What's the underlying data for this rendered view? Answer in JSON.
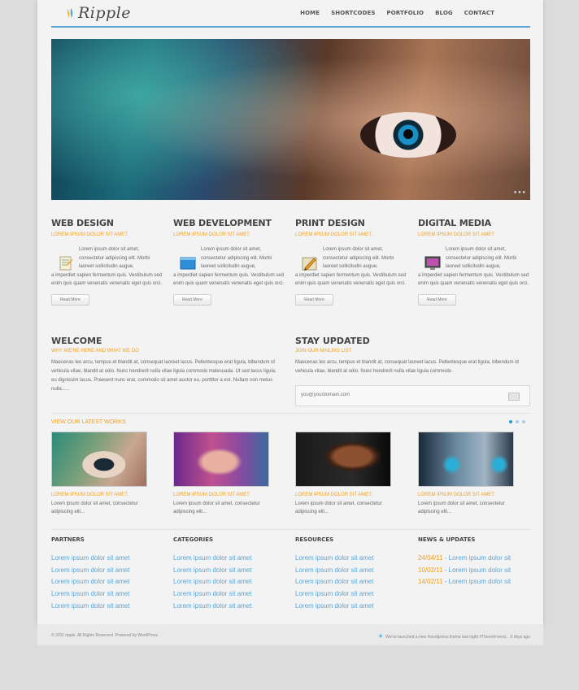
{
  "colors": {
    "accent_blue": "#5aa5d6",
    "accent_orange": "#f0a020",
    "page_bg": "#f3f3f3",
    "outer_bg": "#dcdcdc"
  },
  "header": {
    "logo_text": "Ripple",
    "nav": [
      "HOME",
      "SHORTCODES",
      "PORTFOLIO",
      "BLOG",
      "CONTACT"
    ]
  },
  "hero": {
    "icon": "slider-pager-icon"
  },
  "services": [
    {
      "title": "WEB DESIGN",
      "subtitle": "LOREM IPSUM DOLOR SIT AMET.",
      "icon": "notepad-icon",
      "text_a": "Lorem ipsum dolor sit amet, consectetur adipiscing elit. Morbi laoreet sollicitudin augue,",
      "text_b": "a imperdiet sapien fermentum quis. Vestibulum sed enim quis quam venenatis venenatis eget quis orci.",
      "button": "Read More"
    },
    {
      "title": "WEB DEVELOPMENT",
      "subtitle": "LOREM IPSUM DOLOR SIT AMET.",
      "icon": "blue-window-icon",
      "text_a": "Lorem ipsum dolor sit amet, consectetur adipiscing elit. Morbi laoreet sollicitudin augue,",
      "text_b": "a imperdiet sapien fermentum quis. Vestibulum sed enim quis quam venenatis venenatis eget quis orci.",
      "button": "Read More"
    },
    {
      "title": "PRINT DESIGN",
      "subtitle": "LOREM IPSUM DOLOR SIT AMET.",
      "icon": "pencil-icon",
      "text_a": "Lorem ipsum dolor sit amet, consectetur adipiscing elit. Morbi laoreet sollicitudin augue,",
      "text_b": "a imperdiet sapien fermentum quis. Vestibulum sed enim quis quam venenatis venenatis eget quis orci.",
      "button": "Read More"
    },
    {
      "title": "DIGITAL MEDIA",
      "subtitle": "LOREM IPSUM DOLOR SIT AMET.",
      "icon": "monitor-icon",
      "text_a": "Lorem ipsum dolor sit amet, consectetur adipiscing elit. Morbi laoreet sollicitudin augue,",
      "text_b": "a imperdiet sapien fermentum quis. Vestibulum sed enim quis quam venenatis venenatis eget quis orci.",
      "button": "Read More"
    }
  ],
  "welcome": {
    "title": "WELCOME",
    "subtitle": "WHY WE'RE HERE AND WHAT WE DO",
    "text": "Maecenas leo arcu, tempus et blandit at, consequat laoreet lacus. Pellentesque erat ligula, bibendum id vehicula vitae, blandit at odio. Nunc hendrerit nulla vitae ligula commodo malesuada. Ut sed lacus ligula, eu dignissim lacus. Praesent nunc erat, commodo sit amet auctor eu, porttitor a est. Nullam non metus nulla......"
  },
  "stay_updated": {
    "title": "STAY UPDATED",
    "subtitle": "JOIN OUR MAILING LIST",
    "text": "Maecenas leo arcu, tempus et blandit at, consequat laoreet lacus. Pellentesque erat ligula, bibendum id vehicula vitae, blandit at odio. Nunc hendrerit nulla vitae ligula commodo",
    "email_placeholder": "you@yourdomain.com"
  },
  "works": {
    "heading": "VIEW OUR LATEST WORKS",
    "items": [
      {
        "caption": "LOREM IPSUM DOLOR SIT AMET.",
        "text": "Lorem ipsum dolor sit amet, consectetur adipiscing elit..."
      },
      {
        "caption": "LOREM IPSUM DOLOR SIT AMET.",
        "text": "Lorem ipsum dolor sit amet, consectetur adipiscing elit..."
      },
      {
        "caption": "LOREM IPSUM DOLOR SIT AMET.",
        "text": "Lorem ipsum dolor sit amet, consectetur adipiscing elit..."
      },
      {
        "caption": "LOREM IPSUM DOLOR SIT AMET.",
        "text": "Lorem ipsum dolor sit amet, consectetur adipiscing elit..."
      }
    ]
  },
  "footer_columns": [
    {
      "title": "PARTNERS",
      "links": [
        "Lorem ipsum dolor sit amet",
        "Lorem ipsum dolor sit amet",
        "Lorem ipsum dolor sit amet",
        "Lorem ipsum dolor sit amet",
        "Lorem ipsum dolor sit amet"
      ]
    },
    {
      "title": "CATEGORIES",
      "links": [
        "Lorem ipsum dolor sit amet",
        "Lorem ipsum dolor sit amet",
        "Lorem ipsum dolor sit amet",
        "Lorem ipsum dolor sit amet",
        "Lorem ipsum dolor sit amet"
      ]
    },
    {
      "title": "RESOURCES",
      "links": [
        "Lorem ipsum dolor sit amet",
        "Lorem ipsum dolor sit amet",
        "Lorem ipsum dolor sit amet",
        "Lorem ipsum dolor sit amet",
        "Lorem ipsum dolor sit amet"
      ]
    },
    {
      "title": "NEWS & UPDATES",
      "news": [
        {
          "date": "24/04/11",
          "text": " - Lorem ipsum dolor sit"
        },
        {
          "date": "10/02/11",
          "text": " - Lorem ipsum dolor sit"
        },
        {
          "date": "14/02/11",
          "text": " - Lorem ipsum dolor sit"
        }
      ]
    }
  ],
  "footer": {
    "copyright": "© 2011 ripple. All Rights Reserved. Powered by WordPress",
    "tweet": "We've launched a new #wordpress theme last night #ThemeForest... 6 days ago"
  }
}
